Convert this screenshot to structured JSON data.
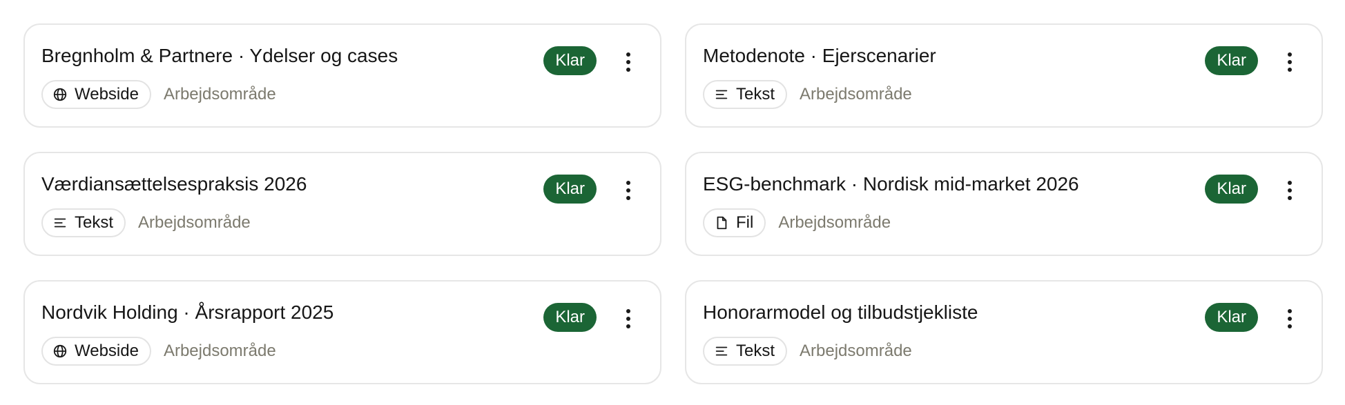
{
  "status_color": "#1b6535",
  "items": [
    {
      "title": "Bregnholm & Partnere · Ydelser og cases",
      "type_label": "Webside",
      "type_icon": "globe-icon",
      "scope": "Arbejdsområde",
      "status": "Klar"
    },
    {
      "title": "Metodenote · Ejerscenarier",
      "type_label": "Tekst",
      "type_icon": "text-lines-icon",
      "scope": "Arbejdsområde",
      "status": "Klar"
    },
    {
      "title": "Værdiansættelsespraksis 2026",
      "type_label": "Tekst",
      "type_icon": "text-lines-icon",
      "scope": "Arbejdsområde",
      "status": "Klar"
    },
    {
      "title": "ESG-benchmark · Nordisk mid-market 2026",
      "type_label": "Fil",
      "type_icon": "file-icon",
      "scope": "Arbejdsområde",
      "status": "Klar"
    },
    {
      "title": "Nordvik Holding · Årsrapport 2025",
      "type_label": "Webside",
      "type_icon": "globe-icon",
      "scope": "Arbejdsområde",
      "status": "Klar"
    },
    {
      "title": "Honorarmodel og tilbudstjekliste",
      "type_label": "Tekst",
      "type_icon": "text-lines-icon",
      "scope": "Arbejdsområde",
      "status": "Klar"
    }
  ]
}
